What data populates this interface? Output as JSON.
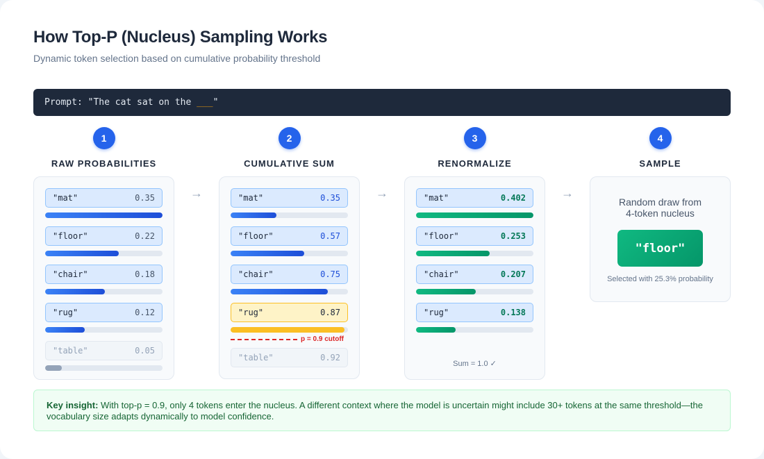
{
  "header": {
    "title": "How Top-P (Nucleus) Sampling Works",
    "subtitle": "Dynamic token selection based on cumulative probability threshold"
  },
  "prompt": {
    "prefix": "Prompt: \"The cat sat on the ",
    "blank": "___",
    "suffix": "\""
  },
  "arrow_glyph": "→",
  "steps": [
    {
      "number": "1",
      "label": "RAW PROBABILITIES",
      "tokens": [
        {
          "token": "\"mat\"",
          "value": "0.35",
          "bar": 1.0
        },
        {
          "token": "\"floor\"",
          "value": "0.22",
          "bar": 0.63
        },
        {
          "token": "\"chair\"",
          "value": "0.18",
          "bar": 0.51
        },
        {
          "token": "\"rug\"",
          "value": "0.12",
          "bar": 0.34
        },
        {
          "token": "\"table\"",
          "value": "0.05",
          "bar": 0.14
        }
      ]
    },
    {
      "number": "2",
      "label": "CUMULATIVE SUM",
      "tokens": [
        {
          "token": "\"mat\"",
          "value": "0.35",
          "bar": 0.39
        },
        {
          "token": "\"floor\"",
          "value": "0.57",
          "bar": 0.63
        },
        {
          "token": "\"chair\"",
          "value": "0.75",
          "bar": 0.83
        },
        {
          "token": "\"rug\"",
          "value": "0.87",
          "bar": 0.97
        },
        {
          "token": "\"table\"",
          "value": "0.92"
        }
      ],
      "cutoff_label": "p = 0.9 cutoff"
    },
    {
      "number": "3",
      "label": "RENORMALIZE",
      "tokens": [
        {
          "token": "\"mat\"",
          "value": "0.402",
          "bar": 1.0
        },
        {
          "token": "\"floor\"",
          "value": "0.253",
          "bar": 0.63
        },
        {
          "token": "\"chair\"",
          "value": "0.207",
          "bar": 0.51
        },
        {
          "token": "\"rug\"",
          "value": "0.138",
          "bar": 0.34
        }
      ],
      "sum_text": "Sum = 1.0 ✓"
    },
    {
      "number": "4",
      "label": "SAMPLE",
      "desc_line1": "Random draw from",
      "desc_line2": "4-token nucleus",
      "selected": "\"floor\"",
      "note": "Selected with 25.3% probability"
    }
  ],
  "insight": {
    "lead": "Key insight:",
    "text": " With top-p = 0.9, only 4 tokens enter the nucleus. A different context where the model is uncertain might include 30+ tokens at the same threshold—the vocabulary size adapts dynamically to model confidence."
  },
  "colors": {
    "accent_blue": "#2563eb",
    "green": "#059669",
    "cutoff_red": "#dc2626",
    "highlight_amber": "#fbbf24"
  }
}
